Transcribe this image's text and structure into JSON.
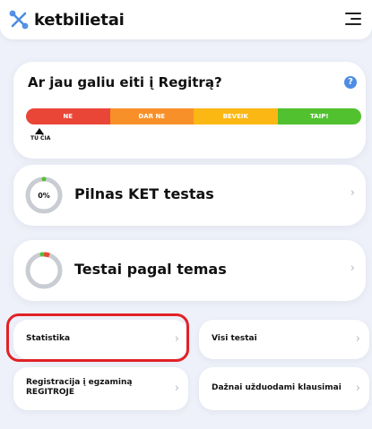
{
  "header": {
    "logo_text": "ketbilietai",
    "logo_icon": "ketbilietai-logo-icon",
    "menu_icon": "hamburger-menu-icon"
  },
  "readiness": {
    "title": "Ar jau galiu eiti į Regitrą?",
    "help_icon": "?",
    "segments": [
      "NE",
      "DAR NE",
      "BEVEIK",
      "TAIP!"
    ],
    "marker_label": "TU ČIA"
  },
  "tests": [
    {
      "title": "Pilnas KET testas",
      "progress_label": "0%",
      "progress": 0
    },
    {
      "title": "Testai pagal temas",
      "progress_label": ""
    }
  ],
  "links": [
    {
      "label": "Statistika"
    },
    {
      "label": "Visi testai"
    },
    {
      "label": "Registracija į egzaminą REGITROJE"
    },
    {
      "label": "Dažnai užduodami klausimai"
    }
  ],
  "colors": {
    "accent": "#4d8de3",
    "ne": "#e94638",
    "dar_ne": "#f79029",
    "beveik": "#fbb714",
    "taip": "#52c12f",
    "highlight": "#e22127"
  }
}
